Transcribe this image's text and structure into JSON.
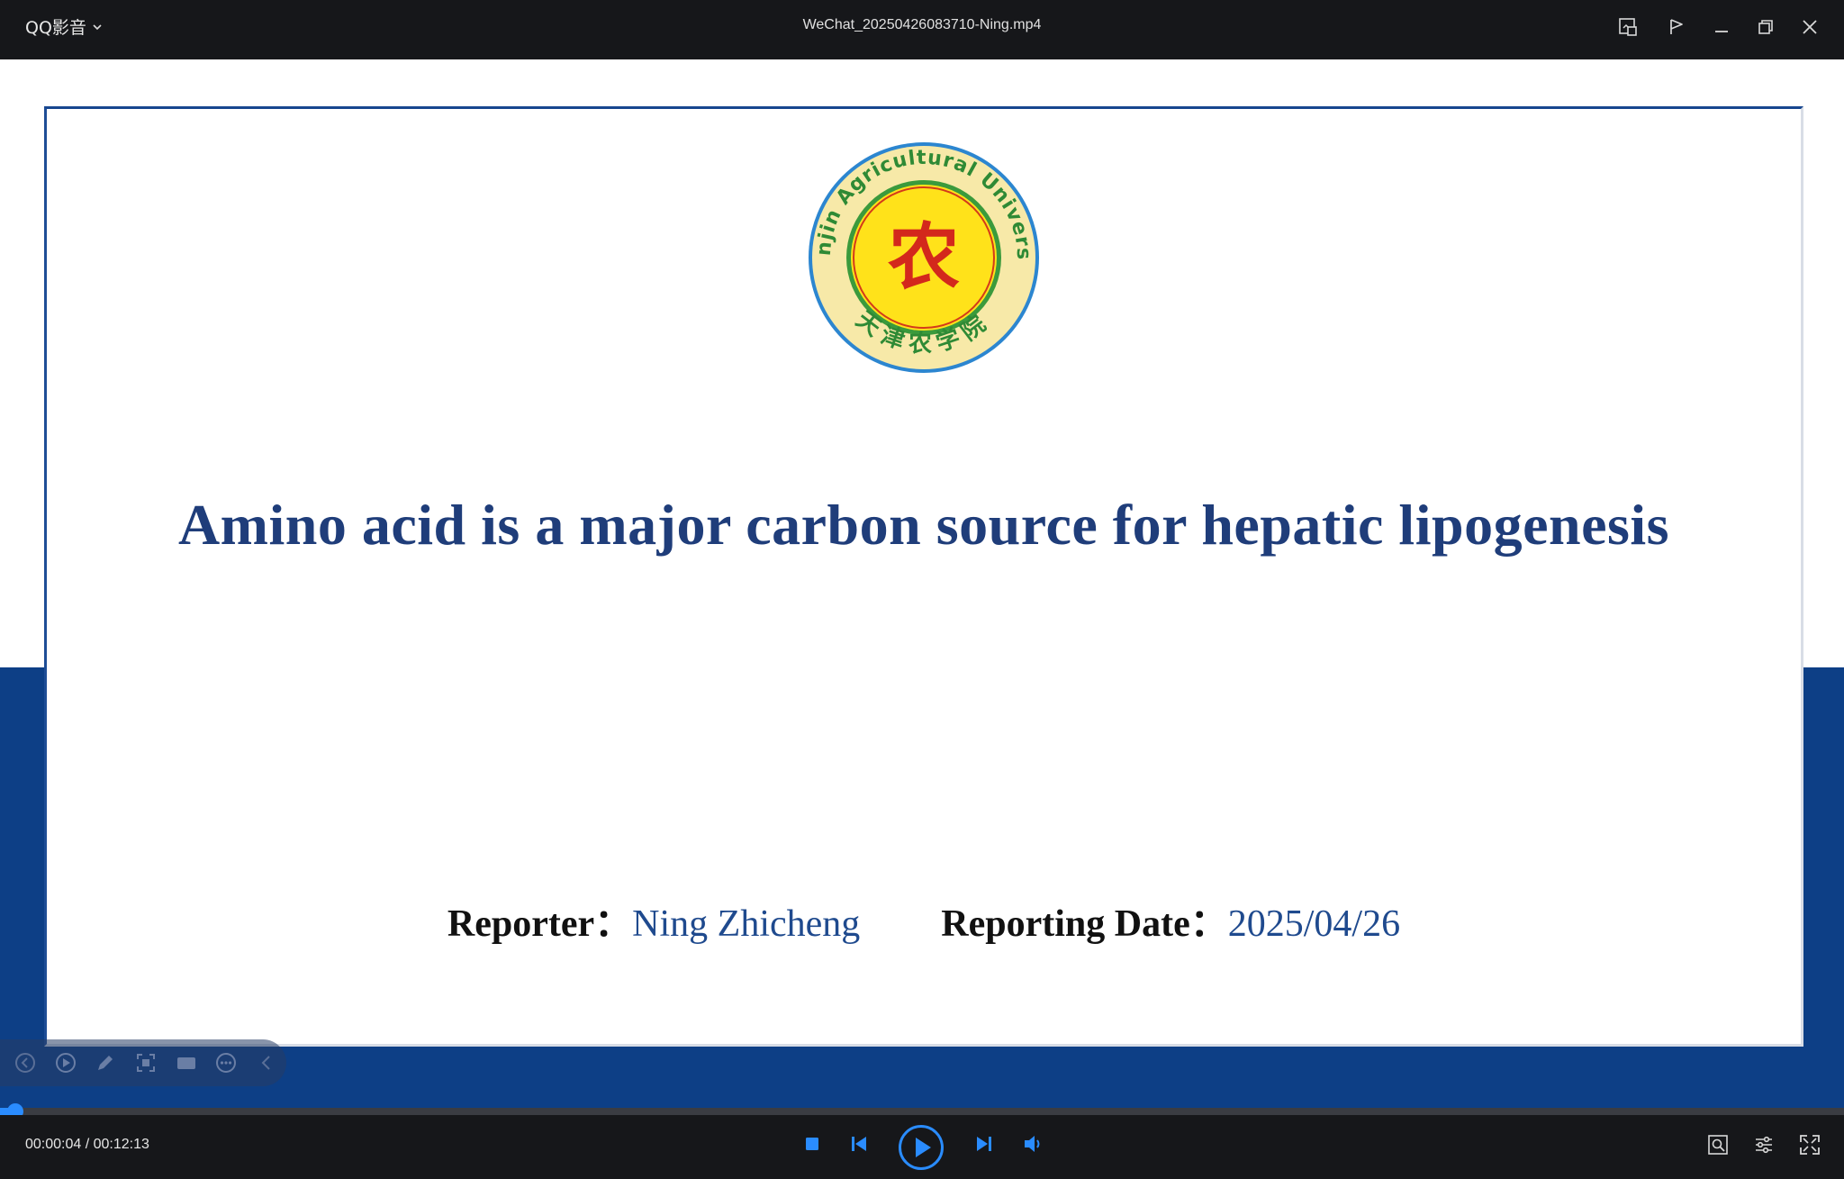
{
  "app": {
    "name": "QQ影音",
    "file_title": "WeChat_20250426083710-Ning.mp4"
  },
  "slide": {
    "title": "Amino acid is a major carbon source for hepatic lipogenesis",
    "reporter_label": "Reporter：",
    "reporter_name": "Ning Zhicheng",
    "date_label": "Reporting Date：",
    "date_value": "2025/04/26",
    "seal": {
      "ring_text": "Tianjin Agricultural University",
      "bottom_text": "天津农学院",
      "center_text": "农"
    }
  },
  "playback": {
    "current_time": "00:00:04",
    "separator": " / ",
    "total_time": "00:12:13",
    "progress_fraction": 0.0055
  },
  "colors": {
    "accent": "#2a8cff",
    "title_blue": "#1f3d7a",
    "band_blue": "#0d3f86"
  },
  "icons": {
    "titlebar": [
      "caret-down-icon",
      "screenshot-icon",
      "pin-icon",
      "minimize-icon",
      "restore-icon",
      "close-icon"
    ],
    "controls": [
      "stop-icon",
      "previous-icon",
      "play-icon",
      "next-icon",
      "volume-icon",
      "picture-settings-icon",
      "settings-icon",
      "fullscreen-icon"
    ],
    "float_toolbar": [
      "rewind-icon",
      "play-circle-icon",
      "pen-icon",
      "capture-icon",
      "camera-icon",
      "more-icon",
      "collapse-icon"
    ]
  }
}
